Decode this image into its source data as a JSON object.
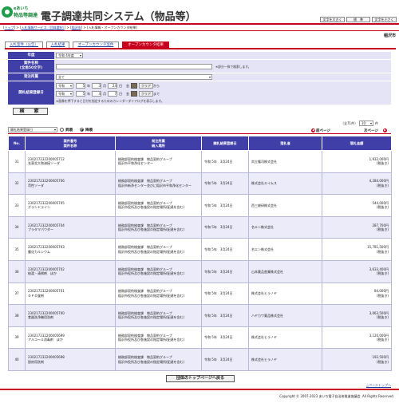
{
  "header": {
    "logo_line1": "eあいち",
    "logo_line2": "物品等調達",
    "title": "電子調達共同システム（物品等）",
    "font_buttons": [
      "文字を大きく",
      "標　準",
      "文字を小さく"
    ]
  },
  "breadcrumb": [
    "トップ",
    "入札情報サービス（団体選択）",
    "稲沢市",
    "入札情報・オープンカウンタ結果"
  ],
  "city": "稲沢市",
  "tabs": [
    "入札案件（公告）",
    "入札結果",
    "オープンカウンタ案件",
    "オープンカウンタ結果"
  ],
  "form": {
    "year_label": "年度",
    "year_value": "令和 4年度",
    "name_label": "案件名称",
    "name_sub": "(全角50文字)",
    "name_value": "",
    "name_note": "※部分一致で検索します。",
    "org_label": "発注所属",
    "org_value": "全て",
    "date_label": "開札結果登録日",
    "era": "令和",
    "from": {
      "year": "5",
      "month": "3",
      "day": "24",
      "dow": "金"
    },
    "to": {
      "year": "5",
      "month": "4",
      "day": "7",
      "dow": "金"
    },
    "year_unit": "年",
    "month_unit": "月",
    "day_unit": "日",
    "clear_label": "クリア",
    "from_suffix": "から",
    "to_suffix": "まで",
    "date_note": "※画像を押下すると日付を指定するためのカレンダーダイアログを表示します。",
    "search_label": "検　索"
  },
  "results": {
    "total": "（全71件）",
    "per_page": "10",
    "per_page_suffix": "件",
    "sort_value": "開札結果登録日",
    "asc_label": "昇順",
    "desc_label": "降順",
    "prev_label": "前ページ",
    "next_label": "次ページ",
    "page_info": "1ページ目",
    "headers": {
      "no": "No.",
      "number": "案件番号",
      "name": "案件名称",
      "org": "発注所属",
      "place": "納入場所",
      "date": "開札結果登録日",
      "winner": "落札者",
      "amount": "落札金額"
    },
    "rows": [
      {
        "no": "31",
        "number": "230217232200005712",
        "name": "名東北大和溶接ソーダ",
        "org": "総務部契約検査課　物品契約グループ",
        "place": "稲沢市平和浄化センター",
        "date": "令和 5年　3月24日",
        "winner": "尚立権司株式会社",
        "amount": "1,932,000円",
        "tax": "(税抜き)"
      },
      {
        "no": "32",
        "number": "230217232200005706",
        "name": "苛性ソーダ",
        "org": "総務部契約検査課　物品契約グループ",
        "place": "稲沢市新浄センター並びに稲沢市平和浄化センター",
        "date": "令和 5年　3月24日",
        "winner": "株式会社エイムス",
        "amount": "4,284,000円",
        "tax": "(税抜き)"
      },
      {
        "no": "33",
        "number": "230217232200005705",
        "name": "グランドライン",
        "org": "総務部契約検査課　物品契約グループ",
        "place": "稲沢市役所及び各施設の指定場所(配達を含む)",
        "date": "令和 5年　3月24日",
        "winner": "西三総研株式会社",
        "amount": "544,000円",
        "tax": "(税抜き)"
      },
      {
        "no": "34",
        "number": "230217232200005704",
        "name": "プラタマパウダー",
        "org": "総務部契約検査課　物品契約グループ",
        "place": "稲沢市役所及び各施設の指定場所(配達を含む)",
        "date": "令和 5年　3月24日",
        "winner": "名エン株式会社",
        "amount": "287,700円",
        "tax": "(税抜き)"
      },
      {
        "no": "35",
        "number": "230217232200005703",
        "name": "塵化カルシウム",
        "org": "総務部契約検査課　物品契約グループ",
        "place": "稲沢市役所及び各施設の指定場所(配達を含む)",
        "date": "令和 5年　3月24日",
        "winner": "名エン株式会社",
        "amount": "15,781,500円",
        "tax": "(税抜き)"
      },
      {
        "no": "36",
        "number": "230217232200005702",
        "name": "給湯・清掃剤　ほか",
        "org": "総務部契約検査課　物品契約グループ",
        "place": "稲沢市役所及び各施設の指定場所(配達を含む)",
        "date": "令和 5年　3月24日",
        "winner": "山本薬品産業株式会社",
        "amount": "3,633,400円",
        "tax": "(税抜き)"
      },
      {
        "no": "37",
        "number": "230217232200005701",
        "name": "ＤＰＤ錠剤",
        "org": "総務部契約検査課　物品契約グループ",
        "place": "稲沢市役所及び各施設の指定場所(配達を含む)",
        "date": "令和 5年　3月24日",
        "winner": "株式会社ヒラノヤ",
        "amount": "84,000円",
        "tax": "(税抜き)"
      },
      {
        "no": "38",
        "number": "230217232200005700",
        "name": "食器洗浄機用洗剤",
        "org": "総務部契約検査課　物品契約グループ",
        "place": "稲沢市役所及び各施設の指定場所(配達を含む)",
        "date": "令和 5年　3月24日",
        "winner": "ハヤカワ薬品株式会社",
        "amount": "3,063,500円",
        "tax": "(税抜き)"
      },
      {
        "no": "39",
        "number": "230217232200005699",
        "name": "アルコール消毒剤　ほか",
        "org": "総務部契約検査課　物品契約グループ",
        "place": "稲沢市役所及び各施設の指定場所(配達を含む)",
        "date": "令和 5年　3月24日",
        "winner": "株式会社ヒラノヤ",
        "amount": "3,120,000円",
        "tax": "(税抜き)"
      },
      {
        "no": "40",
        "number": "230217232200005698",
        "name": "厨房用洗剤",
        "org": "総務部契約検査課　物品契約グループ",
        "place": "稲沢市役所及び各施設の指定場所(配達を含む)",
        "date": "令和 5年　3月24日",
        "winner": "株式会社ヒラノヤ",
        "amount": "192,500円",
        "tax": "(税抜き)"
      }
    ]
  },
  "footer": {
    "back_label": "団体のトップページへ戻る",
    "pagetop_label": "△ページトップへ",
    "copyright": "Copyright © 2007-2023 あいち電子自治体推進協議会. All Rights Reserved."
  }
}
